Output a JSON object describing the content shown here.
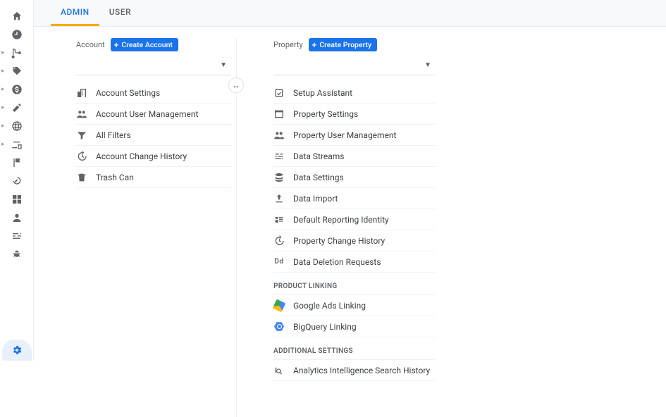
{
  "tabs": {
    "admin": "ADMIN",
    "user": "USER"
  },
  "account": {
    "label": "Account",
    "create_button": "Create Account",
    "items": [
      "Account Settings",
      "Account User Management",
      "All Filters",
      "Account Change History",
      "Trash Can"
    ]
  },
  "property": {
    "label": "Property",
    "create_button": "Create Property",
    "items": [
      "Setup Assistant",
      "Property Settings",
      "Property User Management",
      "Data Streams",
      "Data Settings",
      "Data Import",
      "Default Reporting Identity",
      "Property Change History",
      "Data Deletion Requests"
    ],
    "product_linking_header": "PRODUCT LINKING",
    "product_linking": [
      "Google Ads Linking",
      "BigQuery Linking"
    ],
    "additional_header": "ADDITIONAL SETTINGS",
    "additional": [
      "Analytics Intelligence Search History"
    ]
  }
}
